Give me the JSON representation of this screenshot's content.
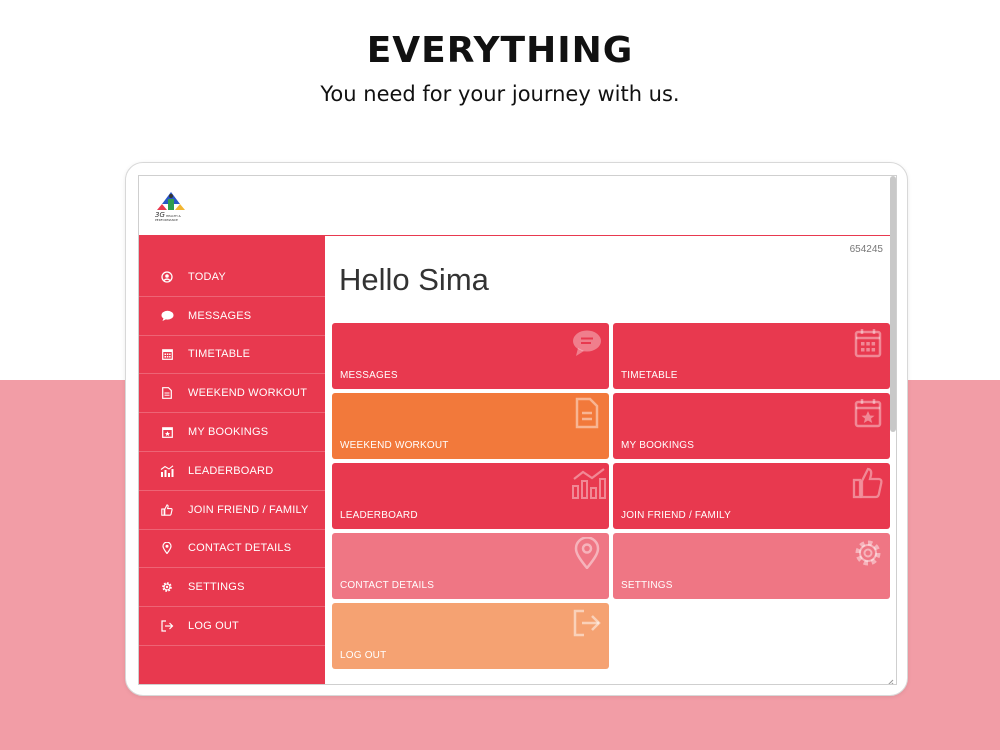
{
  "promo": {
    "headline": "EVERYTHING",
    "subline": "You need for your journey with us."
  },
  "app": {
    "logo_text": "3G HEALTH & PERFORMANCE",
    "user_id": "654245",
    "greeting": "Hello Sima"
  },
  "sidebar": {
    "items": [
      {
        "label": "TODAY",
        "icon": "user-circle-icon"
      },
      {
        "label": "MESSAGES",
        "icon": "chat-bubble-icon"
      },
      {
        "label": "TIMETABLE",
        "icon": "calendar-icon"
      },
      {
        "label": "WEEKEND WORKOUT",
        "icon": "document-icon"
      },
      {
        "label": "MY BOOKINGS",
        "icon": "calendar-star-icon"
      },
      {
        "label": "LEADERBOARD",
        "icon": "chart-icon"
      },
      {
        "label": "JOIN FRIEND / FAMILY",
        "icon": "thumbs-up-icon"
      },
      {
        "label": "CONTACT DETAILS",
        "icon": "map-pin-icon"
      },
      {
        "label": "SETTINGS",
        "icon": "gear-icon"
      },
      {
        "label": "LOG OUT",
        "icon": "logout-icon"
      }
    ]
  },
  "tiles": [
    {
      "label": "MESSAGES",
      "icon": "chat-bubble-icon",
      "color": "#e8394f"
    },
    {
      "label": "TIMETABLE",
      "icon": "calendar-icon",
      "color": "#e8394f"
    },
    {
      "label": "WEEKEND WORKOUT",
      "icon": "document-icon",
      "color": "#f2793b"
    },
    {
      "label": "MY BOOKINGS",
      "icon": "calendar-star-icon",
      "color": "#e8394f"
    },
    {
      "label": "LEADERBOARD",
      "icon": "chart-icon",
      "color": "#e8394f"
    },
    {
      "label": "JOIN FRIEND / FAMILY",
      "icon": "thumbs-up-icon",
      "color": "#e8394f"
    },
    {
      "label": "CONTACT DETAILS",
      "icon": "map-pin-icon",
      "color": "#ef7684"
    },
    {
      "label": "SETTINGS",
      "icon": "gear-icon",
      "color": "#ef7684"
    },
    {
      "label": "LOG OUT",
      "icon": "logout-icon",
      "color": "#f5a272"
    }
  ],
  "colors": {
    "accent": "#e8394f",
    "band": "#f29da6"
  }
}
